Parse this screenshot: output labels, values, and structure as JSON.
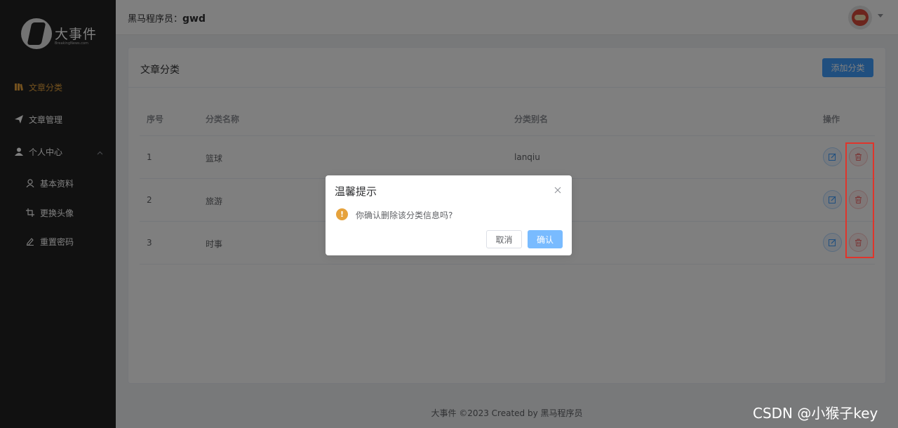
{
  "sidebar": {
    "logo_title": "大事件",
    "logo_sub": "BreakingNews.com",
    "items": [
      {
        "label": "文章分类",
        "icon": "category-icon"
      },
      {
        "label": "文章管理",
        "icon": "send-icon"
      },
      {
        "label": "个人中心",
        "icon": "user-icon"
      },
      {
        "label": "基本资料",
        "icon": "profile-icon"
      },
      {
        "label": "更换头像",
        "icon": "crop-icon"
      },
      {
        "label": "重置密码",
        "icon": "edit-pen-icon"
      }
    ],
    "active_color": "#e6a23c"
  },
  "header": {
    "welcome_prefix": "黑马程序员：",
    "username": "gwd"
  },
  "card": {
    "title": "文章分类",
    "add_button": "添加分类"
  },
  "table": {
    "columns": [
      "序号",
      "分类名称",
      "分类别名",
      "操作"
    ],
    "rows": [
      {
        "index": "1",
        "name": "篮球",
        "alias": "lanqiu"
      },
      {
        "index": "2",
        "name": "旅游",
        "alias": ""
      },
      {
        "index": "3",
        "name": "时事",
        "alias": ""
      }
    ]
  },
  "dialog": {
    "title": "温馨提示",
    "message": "你确认删除该分类信息吗?",
    "cancel": "取消",
    "confirm": "确认"
  },
  "footer": "大事件 ©2023 Created by 黑马程序员",
  "watermark": "CSDN @小猴子key",
  "colors": {
    "primary": "#409eff",
    "sidebar_bg": "#232323",
    "danger": "#f56c6c",
    "highlight": "#e0352b"
  }
}
